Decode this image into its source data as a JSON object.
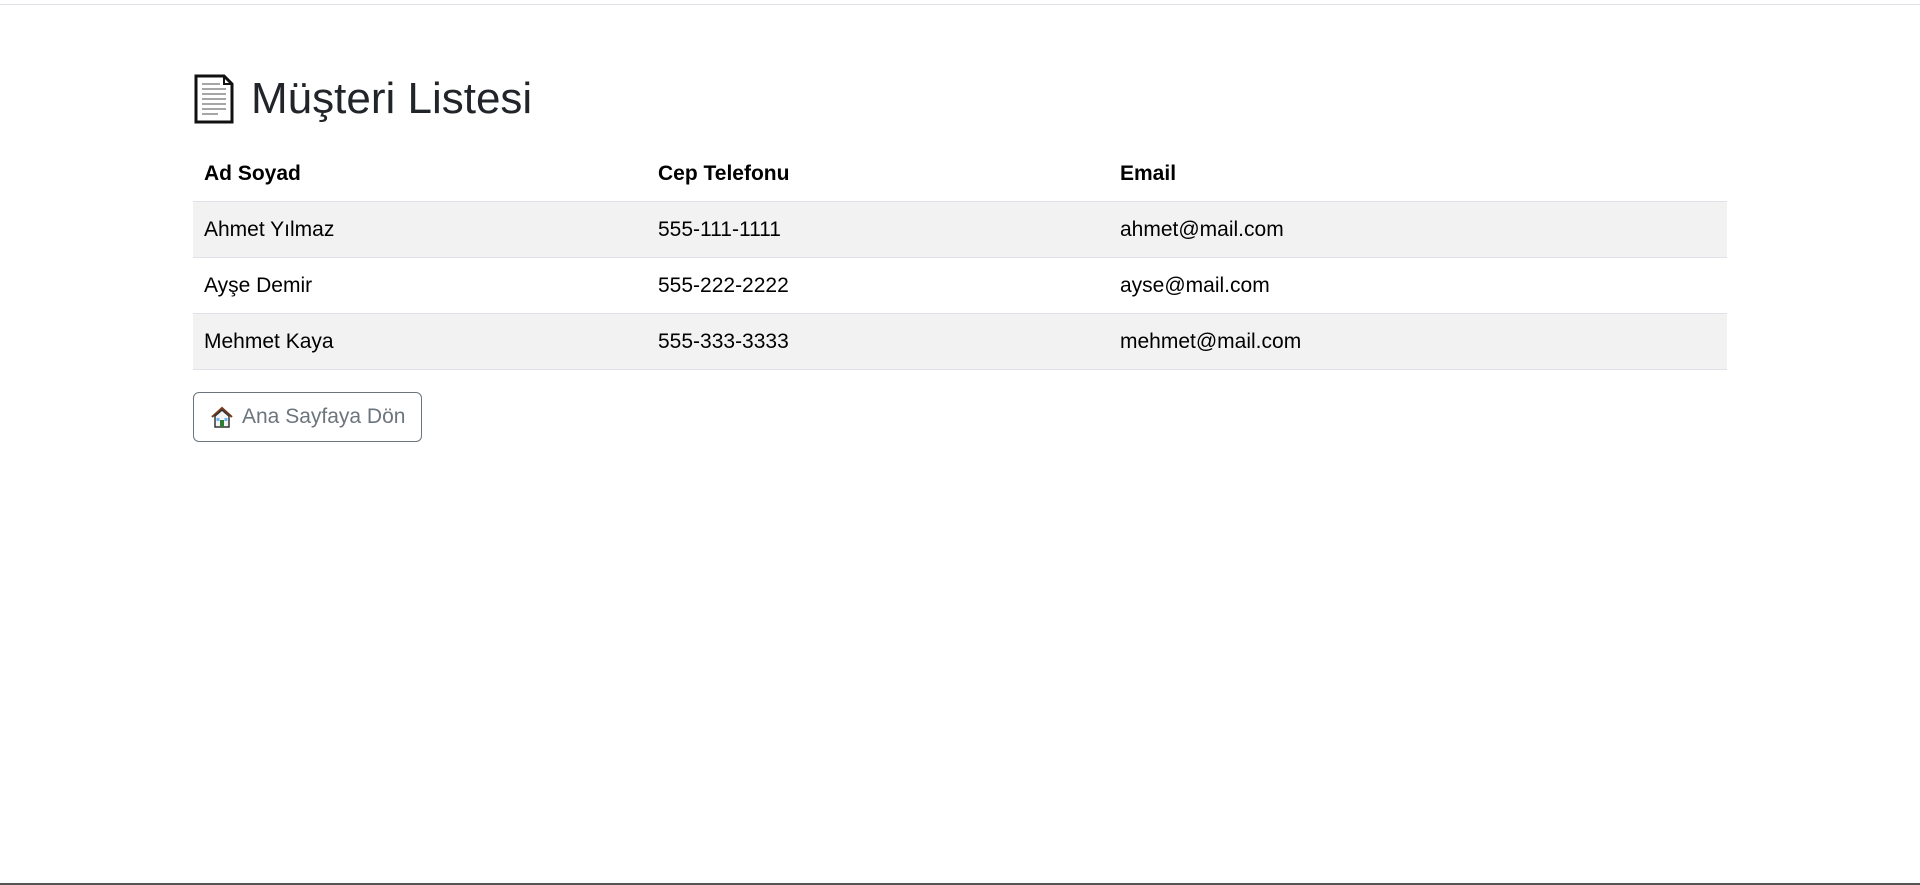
{
  "page": {
    "title": "Müşteri Listesi",
    "title_icon": "document-icon"
  },
  "table": {
    "headers": [
      "Ad Soyad",
      "Cep Telefonu",
      "Email"
    ],
    "rows": [
      {
        "name": "Ahmet Yılmaz",
        "phone": "555-111-1111",
        "email": "ahmet@mail.com"
      },
      {
        "name": "Ayşe Demir",
        "phone": "555-222-2222",
        "email": "ayse@mail.com"
      },
      {
        "name": "Mehmet Kaya",
        "phone": "555-333-3333",
        "email": "mehmet@mail.com"
      }
    ],
    "stripe_color": "#f2f2f2"
  },
  "back_button": {
    "label": "Ana Sayfaya Dön",
    "icon": "house-icon",
    "color": "#6c757d"
  }
}
